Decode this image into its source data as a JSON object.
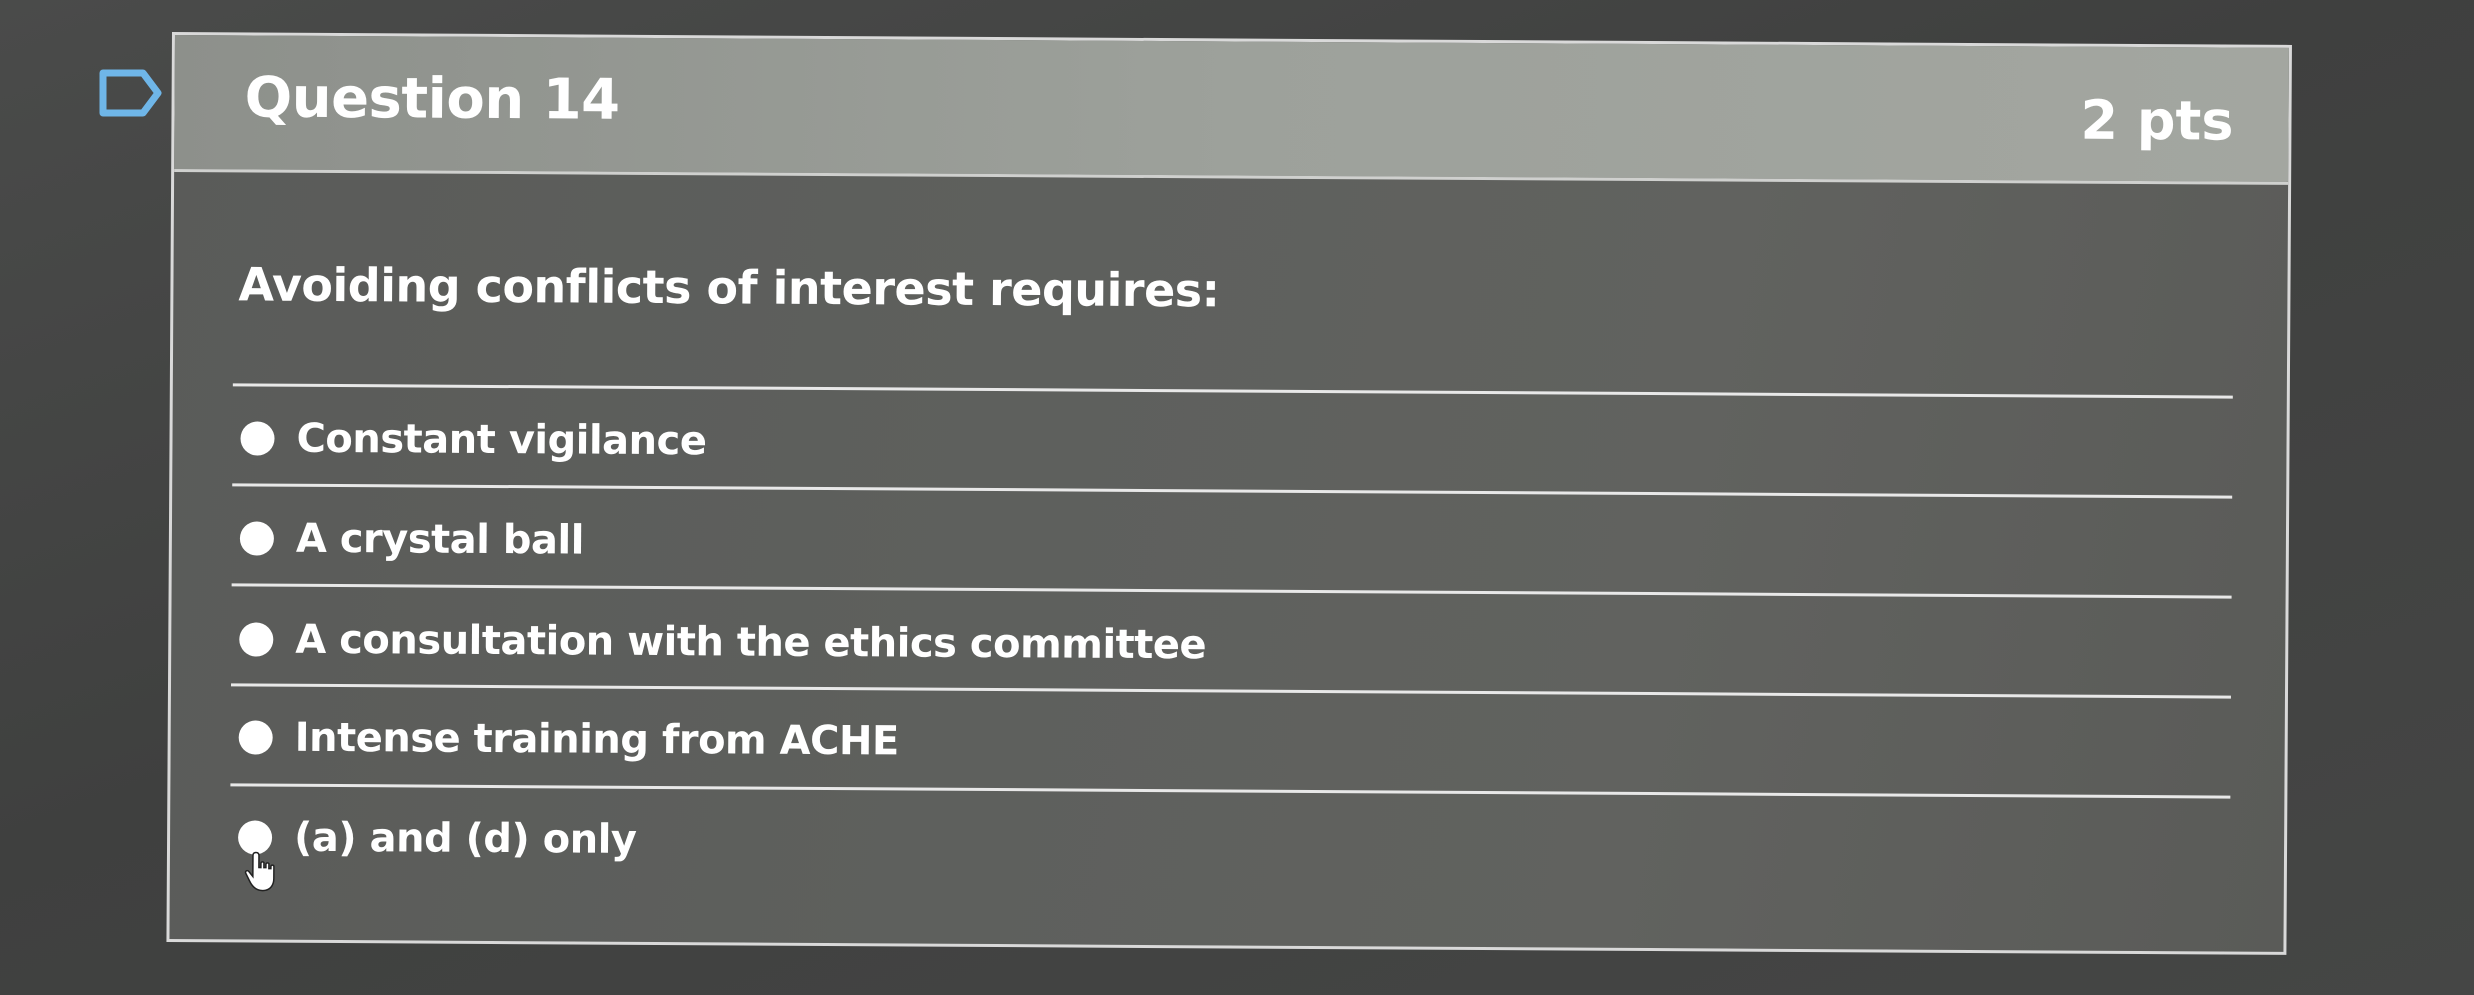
{
  "question": {
    "title": "Question 14",
    "points": "2 pts",
    "text": "Avoiding conflicts of interest requires:",
    "answers": [
      {
        "label": "Constant vigilance",
        "selected": false
      },
      {
        "label": "A crystal ball",
        "selected": false
      },
      {
        "label": "A consultation with the ethics committee",
        "selected": false
      },
      {
        "label": "Intense training from ACHE",
        "selected": false
      },
      {
        "label": "(a) and (d) only",
        "selected": false
      }
    ]
  },
  "icons": {
    "flag": "flag-question-icon",
    "cursor": "hand-pointer-icon"
  },
  "colors": {
    "flag_outline": "#6fb6e8",
    "header_bg": "#9da19b",
    "card_bg": "#5e605d",
    "text": "#ffffff"
  }
}
